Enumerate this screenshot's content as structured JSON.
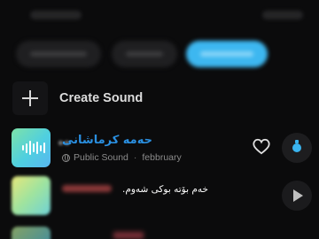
{
  "create": {
    "label": "Create Sound"
  },
  "sound_1": {
    "title": "حەمە کرماشانی",
    "visibility": "Public Sound",
    "author": "febbruary",
    "separator": "·"
  },
  "sound_2": {
    "caption": "خەم بۆتە بوکی شەوم."
  },
  "colors": {
    "accent": "#3ab4ef",
    "title": "#2a8fe0"
  }
}
